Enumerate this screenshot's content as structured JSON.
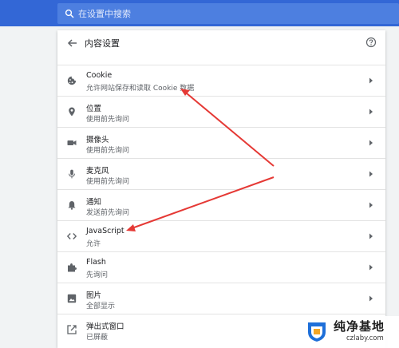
{
  "search": {
    "placeholder": "在设置中搜索"
  },
  "page": {
    "title": "内容设置"
  },
  "settings": [
    {
      "label": "Cookie",
      "sub": "允许网站保存和读取 Cookie 数据",
      "icon": "cookie-icon"
    },
    {
      "label": "位置",
      "sub": "使用前先询问",
      "icon": "location-icon"
    },
    {
      "label": "摄像头",
      "sub": "使用前先询问",
      "icon": "camera-icon"
    },
    {
      "label": "麦克风",
      "sub": "使用前先询问",
      "icon": "microphone-icon"
    },
    {
      "label": "通知",
      "sub": "发送前先询问",
      "icon": "notification-icon"
    },
    {
      "label": "JavaScript",
      "sub": "允许",
      "icon": "code-icon"
    },
    {
      "label": "Flash",
      "sub": "先询问",
      "icon": "puzzle-icon"
    },
    {
      "label": "图片",
      "sub": "全部显示",
      "icon": "image-icon"
    },
    {
      "label": "弹出式窗口",
      "sub": "已屏蔽",
      "icon": "popup-icon"
    }
  ],
  "annotations": {
    "arrow_color": "#e53935"
  },
  "watermark": {
    "title": "纯净基地",
    "url": "czlaby.com"
  },
  "colors": {
    "topbar": "#3367d6",
    "background": "#f1f3f4",
    "card": "#ffffff"
  }
}
